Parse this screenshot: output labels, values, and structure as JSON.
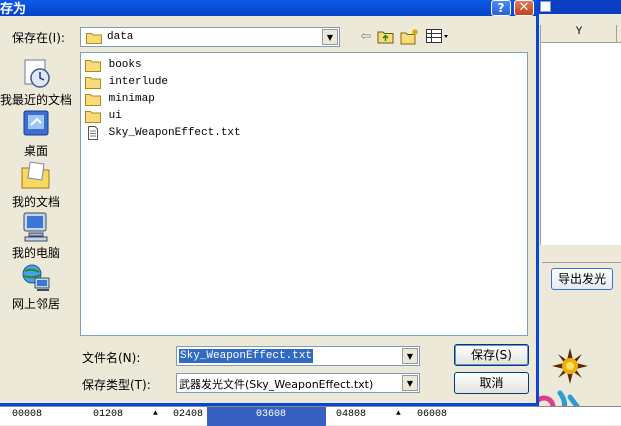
{
  "dialog": {
    "title": "存为",
    "help_label": "?",
    "close_label": "✕",
    "save_in": {
      "label": "保存在(I):",
      "value": "data"
    },
    "toolbar": {
      "back_icon": "back-arrow-icon",
      "up_icon": "up-folder-icon",
      "new_folder_icon": "new-folder-icon",
      "view_icon": "view-menu-icon"
    },
    "places": [
      {
        "label": "我最近的文档",
        "icon": "recent-documents-icon"
      },
      {
        "label": "桌面",
        "icon": "desktop-icon"
      },
      {
        "label": "我的文档",
        "icon": "my-documents-icon"
      },
      {
        "label": "我的电脑",
        "icon": "my-computer-icon"
      },
      {
        "label": "网上邻居",
        "icon": "network-places-icon"
      }
    ],
    "files": [
      {
        "name": "books",
        "type": "folder"
      },
      {
        "name": "interlude",
        "type": "folder"
      },
      {
        "name": "minimap",
        "type": "folder"
      },
      {
        "name": "ui",
        "type": "folder"
      },
      {
        "name": "Sky_WeaponEffect.txt",
        "type": "text-file"
      }
    ],
    "filename": {
      "label": "文件名(N):",
      "value": "Sky_WeaponEffect.txt"
    },
    "filetype": {
      "label": "保存类型(T):",
      "value": "武器发光文件(Sky_WeaponEffect.txt)"
    },
    "buttons": {
      "save": "保存(S)",
      "cancel": "取消"
    }
  },
  "background": {
    "grid_header_y": "Y",
    "export_glow_label": "导出发光",
    "timeline_labels": [
      "00008",
      "01208",
      "02408",
      "03608",
      "04808",
      "06008"
    ],
    "accent_color": "#0a46d4",
    "selection_color": "#316ac5"
  }
}
